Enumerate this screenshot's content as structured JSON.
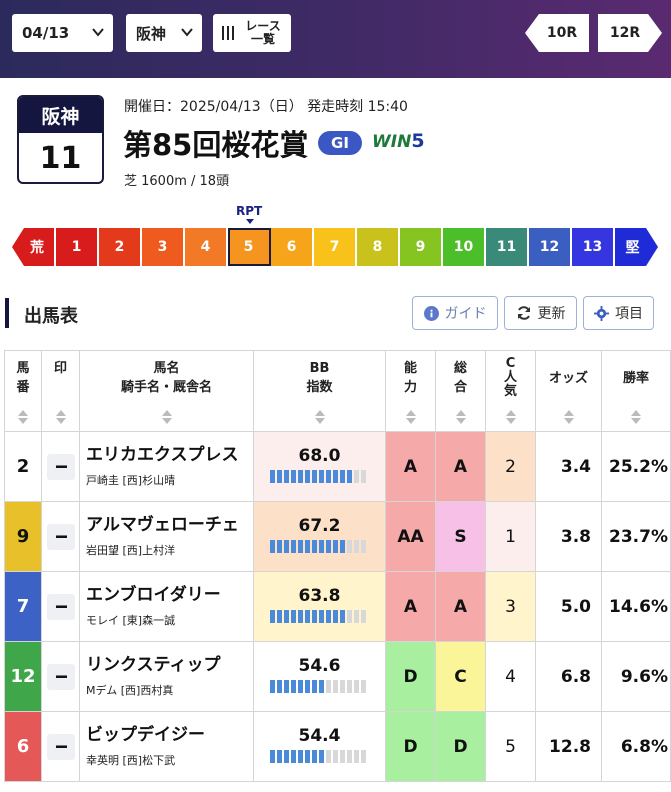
{
  "header": {
    "date": "04/13",
    "venue": "阪神",
    "race_list_label": "レース一覧",
    "race_list_line1": "レース",
    "race_list_line2": "一覧",
    "prev_race": "10R",
    "next_race": "12R"
  },
  "race": {
    "venue": "阪神",
    "number": "11",
    "meta": "開催日：2025/04/13（日） 発走時刻 15:40",
    "name": "第85回桜花賞",
    "grade": "GI",
    "win5_label": "WIN",
    "win5_num": "5",
    "course": "芝 1600m / 18頭"
  },
  "rpt": {
    "label": "RPT",
    "selected": "5",
    "cells": [
      {
        "label": "荒",
        "color": "#d81b1b"
      },
      {
        "label": "1",
        "color": "#d81b1b"
      },
      {
        "label": "2",
        "color": "#e23a1a"
      },
      {
        "label": "3",
        "color": "#ef5a1e"
      },
      {
        "label": "4",
        "color": "#f27a26"
      },
      {
        "label": "5",
        "color": "#f5941e"
      },
      {
        "label": "6",
        "color": "#f6a51b"
      },
      {
        "label": "7",
        "color": "#f8c21a"
      },
      {
        "label": "8",
        "color": "#c9c21c"
      },
      {
        "label": "9",
        "color": "#86c421"
      },
      {
        "label": "10",
        "color": "#4bbe2a"
      },
      {
        "label": "11",
        "color": "#3a8a7a"
      },
      {
        "label": "12",
        "color": "#3b5fc0"
      },
      {
        "label": "13",
        "color": "#3636e0"
      },
      {
        "label": "堅",
        "color": "#1f2bd6"
      }
    ]
  },
  "section": {
    "title": "出馬表",
    "guide": "ガイド",
    "refresh": "更新",
    "items": "項目"
  },
  "table": {
    "headers": {
      "umaban": "馬番",
      "umaban_1": "馬",
      "umaban_2": "番",
      "mark": "印",
      "name_1": "馬名",
      "name_2": "騎手名・厩舎名",
      "bb_1": "BB",
      "bb_2": "指数",
      "ability_1": "能",
      "ability_2": "力",
      "total_1": "総",
      "total_2": "合",
      "c_1": "C",
      "c_2": "人",
      "c_3": "気",
      "odds": "オッズ",
      "winrate": "勝率"
    },
    "rows": [
      {
        "umaban": "2",
        "num_bg": "#ffffff",
        "num_fg": "#111111",
        "mark": "--",
        "name": "エリカエクスプレス",
        "jockey": "戸崎圭 [西]杉山晴",
        "bb": "68.0",
        "bb_level": 0.85,
        "bb_bg": "#fdeeee",
        "ability": "A",
        "ability_bg": "#f6a9a9",
        "total": "A",
        "total_bg": "#f6a9a9",
        "c_pop": "2",
        "c_bg": "#fde0c8",
        "odds": "3.4",
        "winrate": "25.2%"
      },
      {
        "umaban": "9",
        "num_bg": "#e8c02a",
        "num_fg": "#111111",
        "mark": "--",
        "name": "アルマヴェローチェ",
        "jockey": "岩田望 [西]上村洋",
        "bb": "67.2",
        "bb_level": 0.8,
        "bb_bg": "#fde0c8",
        "ability": "AA",
        "ability_bg": "#f6a9a9",
        "total": "S",
        "total_bg": "#f7c0e6",
        "c_pop": "1",
        "c_bg": "#fdeeee",
        "odds": "3.8",
        "winrate": "23.7%"
      },
      {
        "umaban": "7",
        "num_bg": "#3b62c4",
        "num_fg": "#ffffff",
        "mark": "--",
        "name": "エンブロイダリー",
        "jockey": "モレイ [東]森一誠",
        "bb": "63.8",
        "bb_level": 0.75,
        "bb_bg": "#fff4cc",
        "ability": "A",
        "ability_bg": "#f6a9a9",
        "total": "A",
        "total_bg": "#f6a9a9",
        "c_pop": "3",
        "c_bg": "#fff4cc",
        "odds": "5.0",
        "winrate": "14.6%"
      },
      {
        "umaban": "12",
        "num_bg": "#3fa64a",
        "num_fg": "#ffffff",
        "mark": "--",
        "name": "リンクスティップ",
        "jockey": "Mデム [西]西村真",
        "bb": "54.6",
        "bb_level": 0.55,
        "bb_bg": "#ffffff",
        "ability": "D",
        "ability_bg": "#a8f0a0",
        "total": "C",
        "total_bg": "#fbf59a",
        "c_pop": "4",
        "c_bg": "#ffffff",
        "odds": "6.8",
        "winrate": "9.6%"
      },
      {
        "umaban": "6",
        "num_bg": "#e45858",
        "num_fg": "#ffffff",
        "mark": "--",
        "name": "ビップデイジー",
        "jockey": "幸英明 [西]松下武",
        "bb": "54.4",
        "bb_level": 0.55,
        "bb_bg": "#ffffff",
        "ability": "D",
        "ability_bg": "#a8f0a0",
        "total": "D",
        "total_bg": "#a8f0a0",
        "c_pop": "5",
        "c_bg": "#ffffff",
        "odds": "12.8",
        "winrate": "6.8%"
      }
    ]
  }
}
